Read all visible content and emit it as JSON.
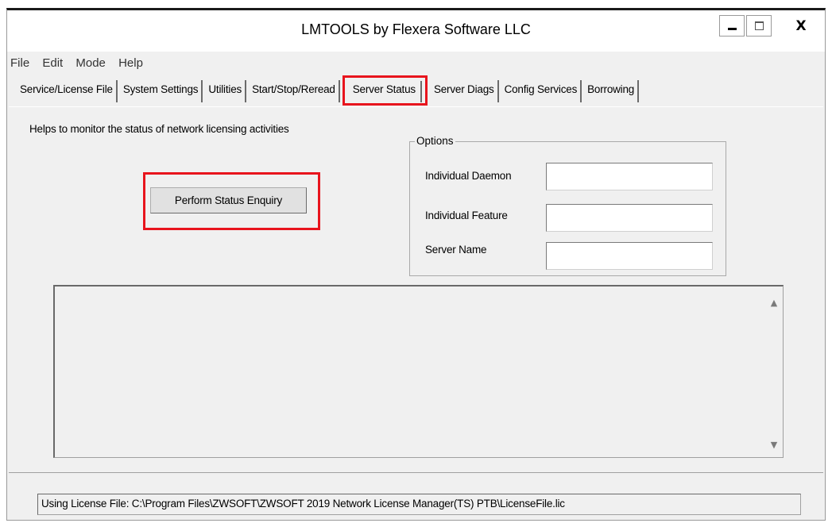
{
  "window": {
    "title": "LMTOOLS by Flexera Software LLC",
    "minimize_icon": "minimize-icon",
    "maximize_icon": "maximize-icon",
    "close_glyph": "X"
  },
  "menu": [
    "File",
    "Edit",
    "Mode",
    "Help"
  ],
  "tabs": [
    "Service/License File",
    "System Settings",
    "Utilities",
    "Start/Stop/Reread",
    "Server Status",
    "Server Diags",
    "Config Services",
    "Borrowing"
  ],
  "active_tab": "Server Status",
  "panel": {
    "description": "Helps to monitor the status of network licensing activities",
    "status_button": "Perform Status Enquiry",
    "options": {
      "legend": "Options",
      "individual_daemon_label": "Individual Daemon",
      "individual_daemon_value": "",
      "individual_feature_label": "Individual Feature",
      "individual_feature_value": "",
      "server_name_label": "Server Name",
      "server_name_value": ""
    },
    "output_text": ""
  },
  "statusbar": "Using License File:  C:\\Program Files\\ZWSOFT\\ZWSOFT 2019 Network License Manager(TS) PTB\\LicenseFile.lic",
  "colors": {
    "highlight": "#e8141d",
    "window_bg": "#f0f0f0"
  }
}
